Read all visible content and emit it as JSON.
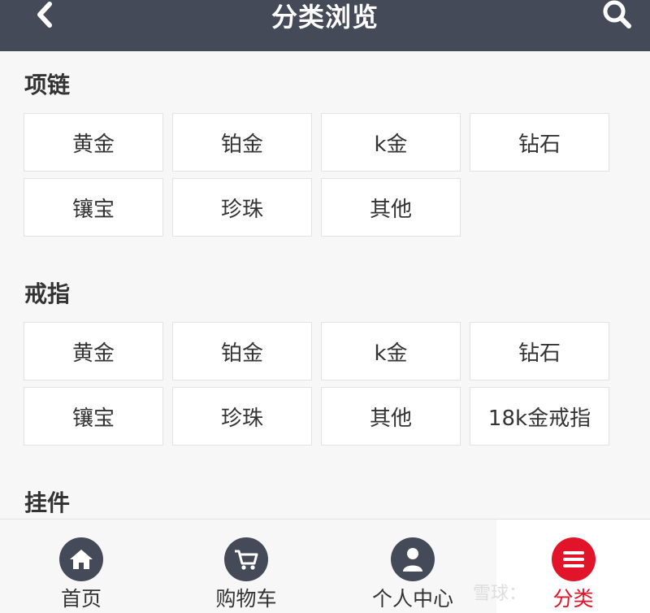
{
  "header": {
    "title": "分类浏览",
    "back_icon": "chevron-left-icon",
    "search_icon": "search-icon"
  },
  "sections": [
    {
      "title": "项链",
      "items": [
        "黄金",
        "铂金",
        "k金",
        "钻石",
        "镶宝",
        "珍珠",
        "其他"
      ]
    },
    {
      "title": "戒指",
      "items": [
        "黄金",
        "铂金",
        "k金",
        "钻石",
        "镶宝",
        "珍珠",
        "其他",
        "18k金戒指"
      ]
    },
    {
      "title": "挂件",
      "items": []
    }
  ],
  "tabbar": {
    "items": [
      {
        "label": "首页",
        "icon": "home-icon"
      },
      {
        "label": "购物车",
        "icon": "cart-icon"
      },
      {
        "label": "个人中心",
        "icon": "user-icon"
      },
      {
        "label": "分类",
        "icon": "menu-icon"
      }
    ],
    "active_index": 3
  },
  "watermark": "雪球：",
  "colors": {
    "header_bg": "#454a59",
    "accent": "#e2142a",
    "page_bg": "#f7f7f7"
  }
}
